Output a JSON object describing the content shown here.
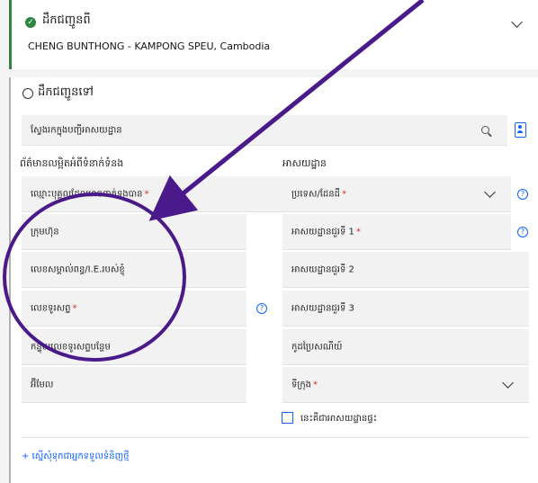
{
  "ship_from": {
    "title": "ដឹកជញ្ជូនពី",
    "address": "CHENG BUNTHONG - KAMPONG SPEU, Cambodia"
  },
  "ship_to": {
    "title": "ដឹកជញ្ជូនទៅ",
    "search_placeholder": "ស្វែងរកក្នុងបញ្ជីអាសយដ្ឋាន",
    "contact_section": "ព័ត៌មានលម្អិតអំពីទំនាក់ទំនង",
    "address_section": "អាសយដ្ឋាន",
    "required_mark": "*",
    "help_symbol": "?",
    "fields": {
      "contact_name": "ឈ្មោះបុគ្គលដែលអាចទាក់ទងបាន",
      "company": "ក្រុមហ៊ុន",
      "tax_id": "លេខសម្គាល់ពន្ធ/I.E.របស់ខ្ញុំ",
      "phone": "លេខទូរសព្ទ",
      "ext_phone": "កន្ទុយលេខទូរសព្ទបន្ថែម",
      "email": "អ៊ីមែល",
      "country": "ប្រទេស/ដែនដី",
      "address1": "អាសយដ្ឋានជួរទី 1",
      "address2": "អាសយដ្ឋានជួរទី 2",
      "address3": "អាសយដ្ឋានជួរទី 3",
      "postal_code": "កូដប្រៃសណីយ៍",
      "city": "ទីក្រុង"
    },
    "residential_label": "នេះគឺជាអាសយដ្ឋានផ្ទះ",
    "add_link": "+ ស្នើសុំទុកជាអ្នកទទួលទំនិញថ្មី"
  },
  "colors": {
    "accent": "#0f62fe",
    "success": "#2e8540",
    "required": "#d32f2f",
    "annotation": "#4b1a8a"
  }
}
